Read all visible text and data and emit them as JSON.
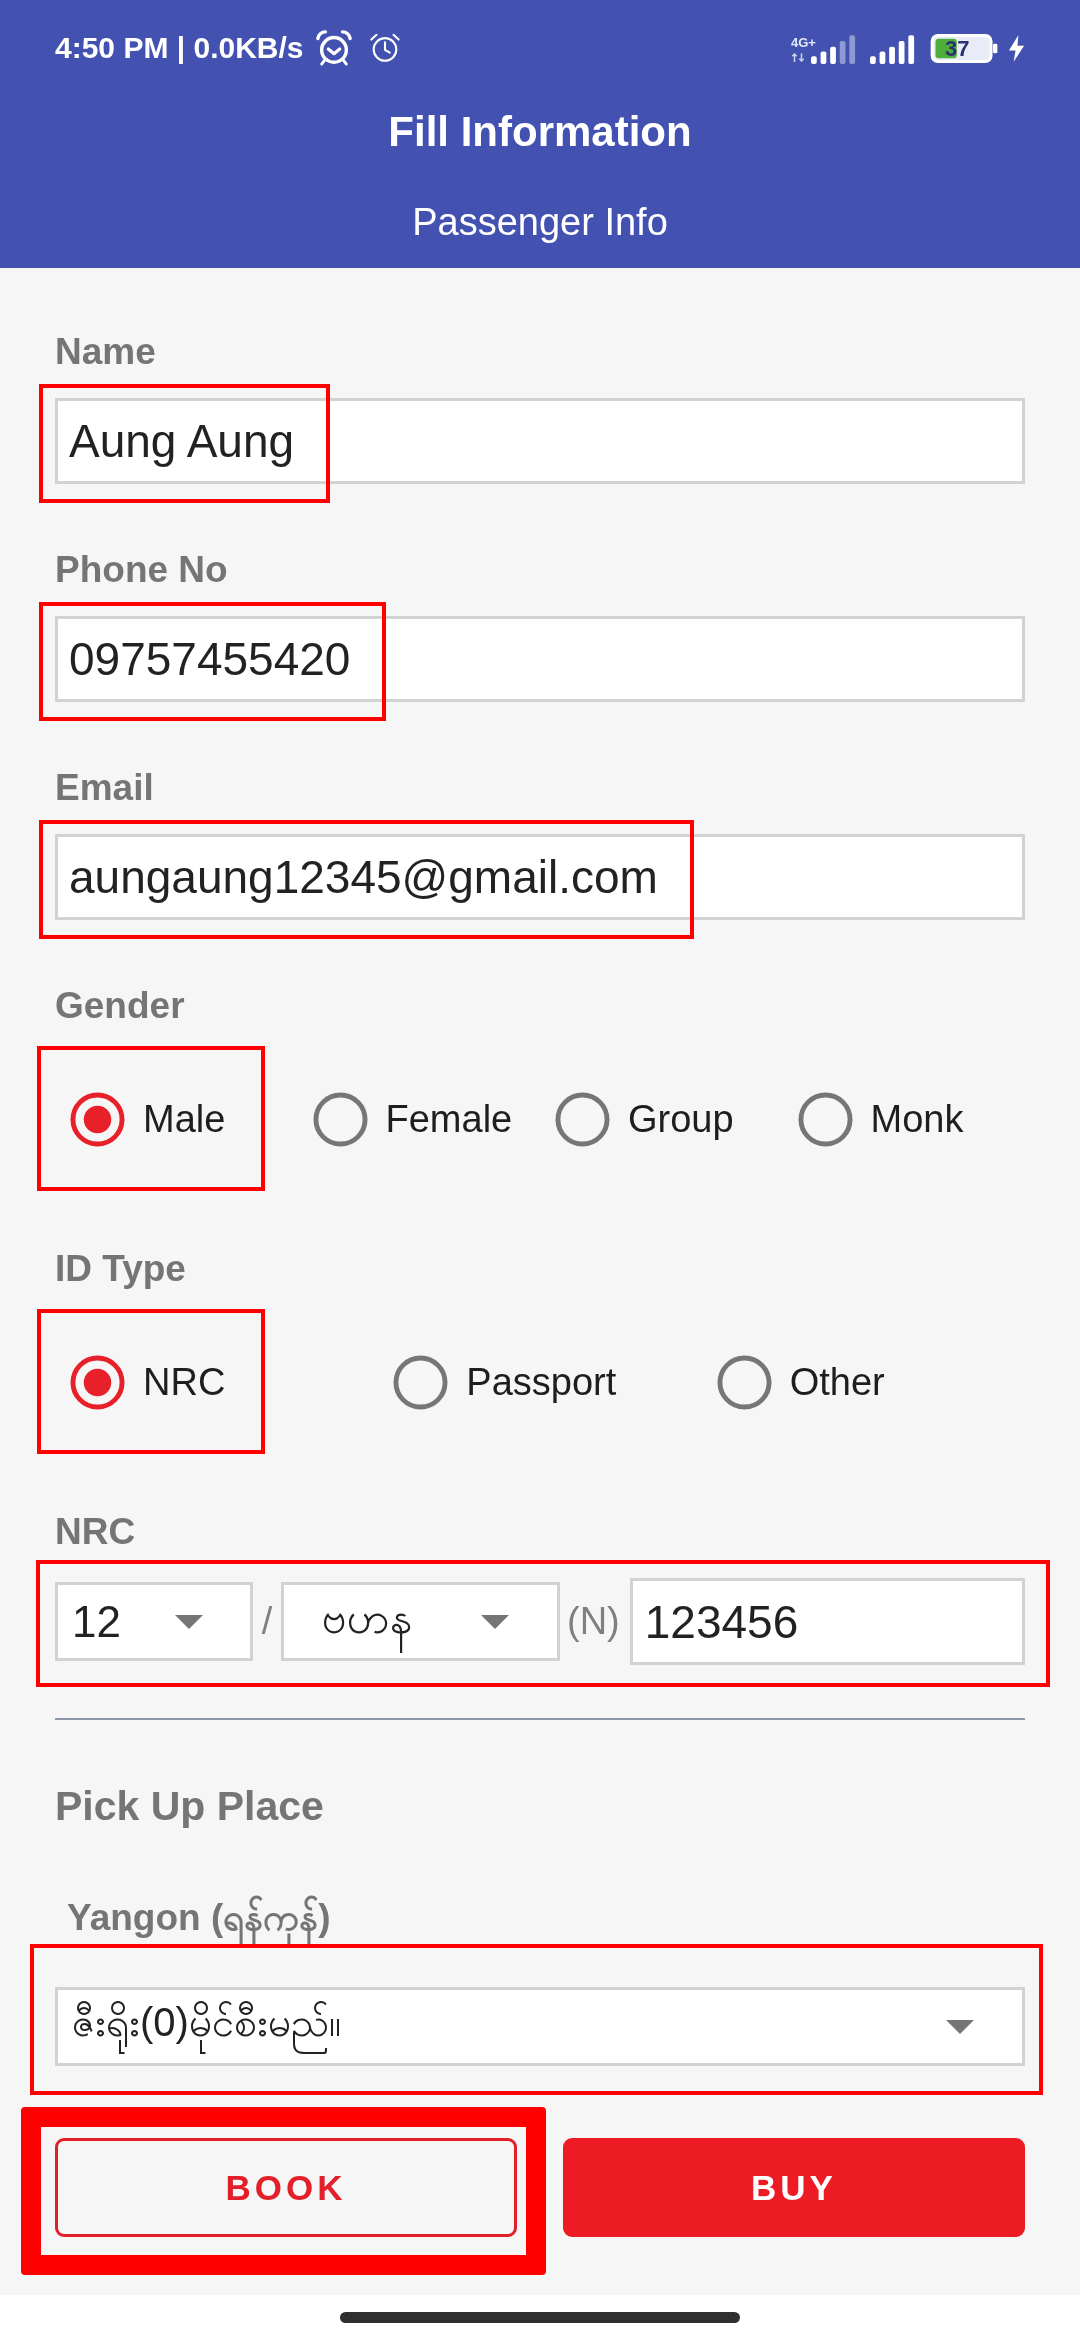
{
  "status_bar": {
    "time": "4:50 PM | 0.0KB/s",
    "network_type": "4G+",
    "battery": "37"
  },
  "app_bar": {
    "title": "Fill Information",
    "subtitle": "Passenger Info"
  },
  "text_fields": [
    {
      "label": "Name",
      "value": "Aung Aung",
      "highlighted": true
    },
    {
      "label": "Phone No",
      "value": "09757455420",
      "highlighted": true
    },
    {
      "label": "Email",
      "value": "aungaung12345@gmail.com",
      "highlighted": true
    }
  ],
  "radio_groups": [
    {
      "label": "Gender",
      "options": [
        {
          "label": "Male",
          "selected": true,
          "highlighted": true
        },
        {
          "label": "Female",
          "selected": false,
          "highlighted": false
        },
        {
          "label": "Group",
          "selected": false,
          "highlighted": false
        },
        {
          "label": "Monk",
          "selected": false,
          "highlighted": false
        }
      ]
    },
    {
      "label": "ID Type",
      "options": [
        {
          "label": "NRC",
          "selected": true,
          "highlighted": true
        },
        {
          "label": "Passport",
          "selected": false,
          "highlighted": false
        },
        {
          "label": "Other",
          "selected": false,
          "highlighted": false
        }
      ]
    }
  ],
  "nrc": {
    "label": "NRC",
    "state_code": "12",
    "separator": "/",
    "township": "ဗဟန",
    "citizenship": "(N)",
    "number": "123456",
    "highlighted": true
  },
  "pick_up": {
    "heading": "Pick Up Place",
    "city": "Yangon (ရန်ကုန်)",
    "place": "ဇီးရိုး(0)မိုင်စီးမည်။",
    "highlighted": true
  },
  "buttons": [
    {
      "label": "BOOK",
      "kind": "outlined",
      "highlighted": true
    },
    {
      "label": "BUY",
      "kind": "filled",
      "highlighted": false
    }
  ]
}
